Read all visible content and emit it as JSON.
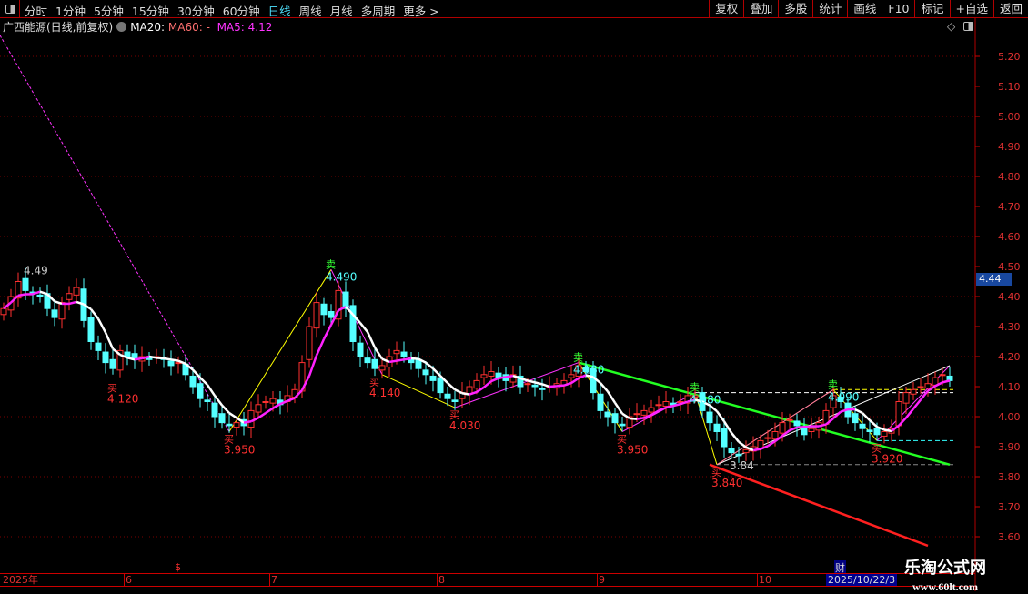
{
  "toolbar": {
    "periods": [
      "分时",
      "1分钟",
      "5分钟",
      "15分钟",
      "30分钟",
      "60分钟",
      "日线",
      "周线",
      "月线",
      "多周期",
      "更多 >"
    ],
    "active_period": "日线",
    "right_buttons": [
      "复权",
      "叠加",
      "多股",
      "统计",
      "画线",
      "F10",
      "标记",
      "+自选",
      "返回"
    ]
  },
  "header": {
    "title": "广西能源(日线,前复权)",
    "ma20": "MA20:",
    "ma60": "MA60: -",
    "ma5": "MA5: 4.12"
  },
  "current_price": "4.44",
  "tags": {
    "cai": "财",
    "s": "$"
  },
  "x_axis": {
    "labels": [
      "2025年",
      "6",
      "7",
      "8",
      "9",
      "10"
    ],
    "selected_date": "2025/10/22/3"
  },
  "watermark": {
    "line1": "乐淘公式网",
    "line2": "www.60lt.com"
  },
  "colors": {
    "up": "#ff3030",
    "down": "#54ffff",
    "ma_up": "#ff22ff",
    "ma_down": "#ffffff",
    "grid": "#7a0000",
    "accent": "#4fe3ff"
  },
  "chart_data": {
    "type": "candlestick",
    "ylim": [
      3.55,
      5.27
    ],
    "y_ticks": [
      5.2,
      5.1,
      5.0,
      4.9,
      4.8,
      4.7,
      4.6,
      4.5,
      4.4,
      4.3,
      4.2,
      4.1,
      4.0,
      3.9,
      3.8,
      3.7,
      3.6
    ],
    "x_month_labels": [
      {
        "label": "2025年",
        "index": 0
      },
      {
        "label": "6",
        "index": 17
      },
      {
        "label": "7",
        "index": 37
      },
      {
        "label": "8",
        "index": 60
      },
      {
        "label": "9",
        "index": 82
      },
      {
        "label": "10",
        "index": 104
      }
    ],
    "closes": [
      4.36,
      4.4,
      4.45,
      4.42,
      4.41,
      4.4,
      4.36,
      4.33,
      4.38,
      4.41,
      4.43,
      4.32,
      4.25,
      4.22,
      4.18,
      4.16,
      4.22,
      4.2,
      4.19,
      4.2,
      4.19,
      4.2,
      4.19,
      4.17,
      4.18,
      4.14,
      4.1,
      4.06,
      4.05,
      4.0,
      3.98,
      3.97,
      3.98,
      3.97,
      4.02,
      4.04,
      4.05,
      4.06,
      4.04,
      4.07,
      4.09,
      4.18,
      4.3,
      4.38,
      4.34,
      4.33,
      4.42,
      4.36,
      4.25,
      4.2,
      4.18,
      4.16,
      4.17,
      4.2,
      4.22,
      4.2,
      4.18,
      4.16,
      4.14,
      4.12,
      4.08,
      4.06,
      4.05,
      4.08,
      4.1,
      4.12,
      4.14,
      4.15,
      4.13,
      4.12,
      4.14,
      4.1,
      4.11,
      4.1,
      4.09,
      4.1,
      4.11,
      4.12,
      4.14,
      4.17,
      4.15,
      4.08,
      4.02,
      4.0,
      3.98,
      3.97,
      4.0,
      4.01,
      4.02,
      4.03,
      4.04,
      4.05,
      4.04,
      4.05,
      4.07,
      4.07,
      4.02,
      3.98,
      3.95,
      3.9,
      3.88,
      3.87,
      3.89,
      3.9,
      3.92,
      3.93,
      3.95,
      3.98,
      3.99,
      3.97,
      3.94,
      3.96,
      3.98,
      4.02,
      4.07,
      4.05,
      4.0,
      3.98,
      3.96,
      3.95,
      3.94,
      3.95,
      3.96,
      4.05,
      4.08,
      4.09,
      4.1,
      4.11,
      4.13,
      4.14,
      4.12
    ],
    "ma_period": 5,
    "annotations": [
      {
        "text": "4.49",
        "index": 2,
        "price": 4.49,
        "color": "#cccccc",
        "mark": ""
      },
      {
        "text": "4.120",
        "index": 15,
        "price": 4.12,
        "color": "#ff3030",
        "mark": "买"
      },
      {
        "text": "3.950",
        "index": 31,
        "price": 3.95,
        "color": "#ff3030",
        "mark": "买"
      },
      {
        "text": "4.490",
        "index": 45,
        "price": 4.49,
        "color": "#54ffff",
        "mark": "卖"
      },
      {
        "text": "4.140",
        "index": 51,
        "price": 4.14,
        "color": "#ff3030",
        "mark": "买"
      },
      {
        "text": "4.030",
        "index": 62,
        "price": 4.03,
        "color": "#ff3030",
        "mark": "买"
      },
      {
        "text": "4.180",
        "index": 79,
        "price": 4.18,
        "color": "#54ffff",
        "mark": "卖"
      },
      {
        "text": "3.950",
        "index": 85,
        "price": 3.95,
        "color": "#ff3030",
        "mark": "买"
      },
      {
        "text": "4.080",
        "index": 95,
        "price": 4.08,
        "color": "#54ffff",
        "mark": "卖"
      },
      {
        "text": "3.840",
        "index": 98,
        "price": 3.84,
        "color": "#ff3030",
        "mark": "买"
      },
      {
        "text": "3.84",
        "index": 99,
        "price": 3.84,
        "color": "#cccccc",
        "mark": ""
      },
      {
        "text": "4.090",
        "index": 114,
        "price": 4.09,
        "color": "#54ffff",
        "mark": "卖"
      },
      {
        "text": "3.920",
        "index": 120,
        "price": 3.92,
        "color": "#ff3030",
        "mark": "买"
      }
    ],
    "zigzag": [
      [
        -0.5,
        5.27
      ],
      [
        31,
        3.95
      ],
      [
        45,
        4.49
      ],
      [
        52,
        4.14
      ],
      [
        62,
        4.03
      ],
      [
        79,
        4.18
      ],
      [
        85,
        3.95
      ],
      [
        95,
        4.08
      ],
      [
        98,
        3.84
      ],
      [
        114,
        4.09
      ],
      [
        120,
        3.92
      ],
      [
        130,
        4.17
      ]
    ],
    "trend_lines": [
      {
        "from": [
          79,
          4.18
        ],
        "to": [
          130,
          3.84
        ],
        "color": "#22ff22"
      },
      {
        "from": [
          97,
          3.84
        ],
        "to": [
          127,
          3.57
        ],
        "color": "#ff2020"
      },
      {
        "from": [
          98,
          3.84
        ],
        "to": [
          130,
          4.17
        ],
        "color": "#ffffff"
      },
      {
        "from": [
          98,
          3.84
        ],
        "to": [
          114,
          4.09
        ],
        "color": "#ff8888"
      }
    ],
    "level_lines": [
      {
        "price": 4.08,
        "from": 95,
        "color": "#ffffff"
      },
      {
        "price": 4.09,
        "from": 114,
        "color": "#ffff00"
      },
      {
        "price": 3.92,
        "from": 120,
        "color": "#33ffff"
      },
      {
        "price": 3.84,
        "from": 98,
        "color": "#888888"
      }
    ]
  }
}
